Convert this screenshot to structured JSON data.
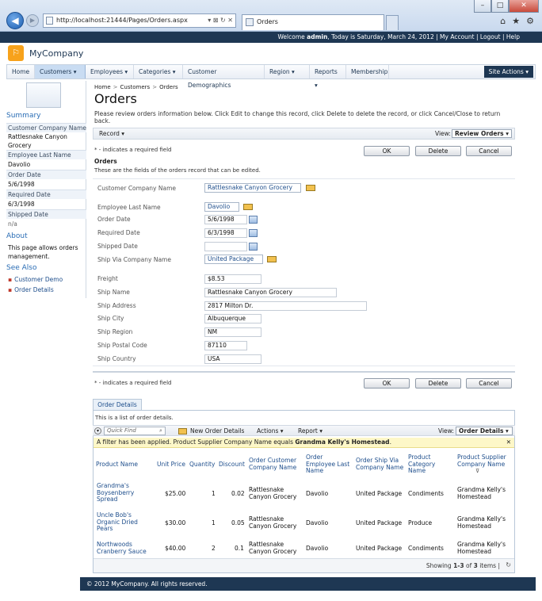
{
  "browser": {
    "url": "http://localhost:21444/Pages/Orders.aspx",
    "tab_title": "Orders",
    "controls": {
      "minimize": "–",
      "maximize": "□",
      "close": "✕"
    },
    "tools": {
      "home": "⌂",
      "fav": "★",
      "gear": "⚙"
    }
  },
  "topbar": {
    "welcome_prefix": "Welcome ",
    "user": "admin",
    "welcome_suffix": ", Today is Saturday, March 24, 2012",
    "my_account": "My Account",
    "logout": "Logout",
    "help": "Help"
  },
  "brand": "MyCompany",
  "menu": [
    "Home",
    "Customers ▾",
    "Employees ▾",
    "Categories ▾",
    "Customer Demographics",
    "Region ▾",
    "Reports ▾",
    "Membership"
  ],
  "site_actions": "Site Actions ▾",
  "sidebar": {
    "summary_title": "Summary",
    "fields": [
      {
        "label": "Customer Company Name",
        "value": "Rattlesnake Canyon Grocery"
      },
      {
        "label": "Employee Last Name",
        "value": "Davolio"
      },
      {
        "label": "Order Date",
        "value": "5/6/1998"
      },
      {
        "label": "Required Date",
        "value": "6/3/1998"
      },
      {
        "label": "Shipped Date",
        "value": "n/a"
      }
    ],
    "about_title": "About",
    "about_text": "This page allows orders management.",
    "see_also_title": "See Also",
    "see_also": [
      "Customer Demo",
      "Order Details"
    ]
  },
  "breadcrumb": {
    "home": "Home",
    "customers": "Customers",
    "current": "Orders"
  },
  "page_title": "Orders",
  "instructions": "Please review orders information below. Click Edit to change this record, click Delete to delete the record, or click Cancel/Close to return back.",
  "record_menu": "Record ▾",
  "view_label": "View:",
  "view_value": "Review Orders ▾",
  "buttons": {
    "ok": "OK",
    "delete": "Delete",
    "cancel": "Cancel"
  },
  "required_note": "* - indicates a required field",
  "section_title": "Orders",
  "section_desc": "These are the fields of the orders record that can be edited.",
  "form": {
    "customer_company_label": "Customer Company Name",
    "customer_company": "Rattlesnake Canyon Grocery",
    "employee_label": "Employee Last Name",
    "employee": "Davolio",
    "order_date_label": "Order Date",
    "order_date": "5/6/1998",
    "required_date_label": "Required Date",
    "required_date": "6/3/1998",
    "shipped_date_label": "Shipped Date",
    "shipped_date": "",
    "ship_via_label": "Ship Via Company Name",
    "ship_via": "United Package",
    "freight_label": "Freight",
    "freight": "$8.53",
    "ship_name_label": "Ship Name",
    "ship_name": "Rattlesnake Canyon Grocery",
    "ship_address_label": "Ship Address",
    "ship_address": "2817 Milton Dr.",
    "ship_city_label": "Ship City",
    "ship_city": "Albuquerque",
    "ship_region_label": "Ship Region",
    "ship_region": "NM",
    "ship_postal_label": "Ship Postal Code",
    "ship_postal": "87110",
    "ship_country_label": "Ship Country",
    "ship_country": "USA"
  },
  "details": {
    "tab": "Order Details",
    "desc": "This is a list of order details.",
    "quick_find": "Quick Find",
    "new_label": "New Order Details",
    "actions": "Actions ▾",
    "report": "Report ▾",
    "view_label": "View:",
    "view_value": "Order Details ▾",
    "filter_prefix": "A filter has been applied. Product Supplier Company Name equals ",
    "filter_value": "Grandma Kelly's Homestead",
    "filter_suffix": ".",
    "headers": [
      "Product Name",
      "Unit Price",
      "Quantity",
      "Discount",
      "Order Customer Company Name",
      "Order Employee Last Name",
      "Order Ship Via Company Name",
      "Product Category Name",
      "Product Supplier Company Name"
    ],
    "rows": [
      [
        "Grandma's Boysenberry Spread",
        "$25.00",
        "1",
        "0.02",
        "Rattlesnake Canyon Grocery",
        "Davolio",
        "United Package",
        "Condiments",
        "Grandma Kelly's Homestead"
      ],
      [
        "Uncle Bob's Organic Dried Pears",
        "$30.00",
        "1",
        "0.05",
        "Rattlesnake Canyon Grocery",
        "Davolio",
        "United Package",
        "Produce",
        "Grandma Kelly's Homestead"
      ],
      [
        "Northwoods Cranberry Sauce",
        "$40.00",
        "2",
        "0.1",
        "Rattlesnake Canyon Grocery",
        "Davolio",
        "United Package",
        "Condiments",
        "Grandma Kelly's Homestead"
      ]
    ],
    "showing_prefix": "Showing ",
    "showing_range": "1-3",
    "showing_of": " of ",
    "showing_total": "3",
    "showing_suffix": " items |"
  },
  "footer": "© 2012 MyCompany. All rights reserved."
}
